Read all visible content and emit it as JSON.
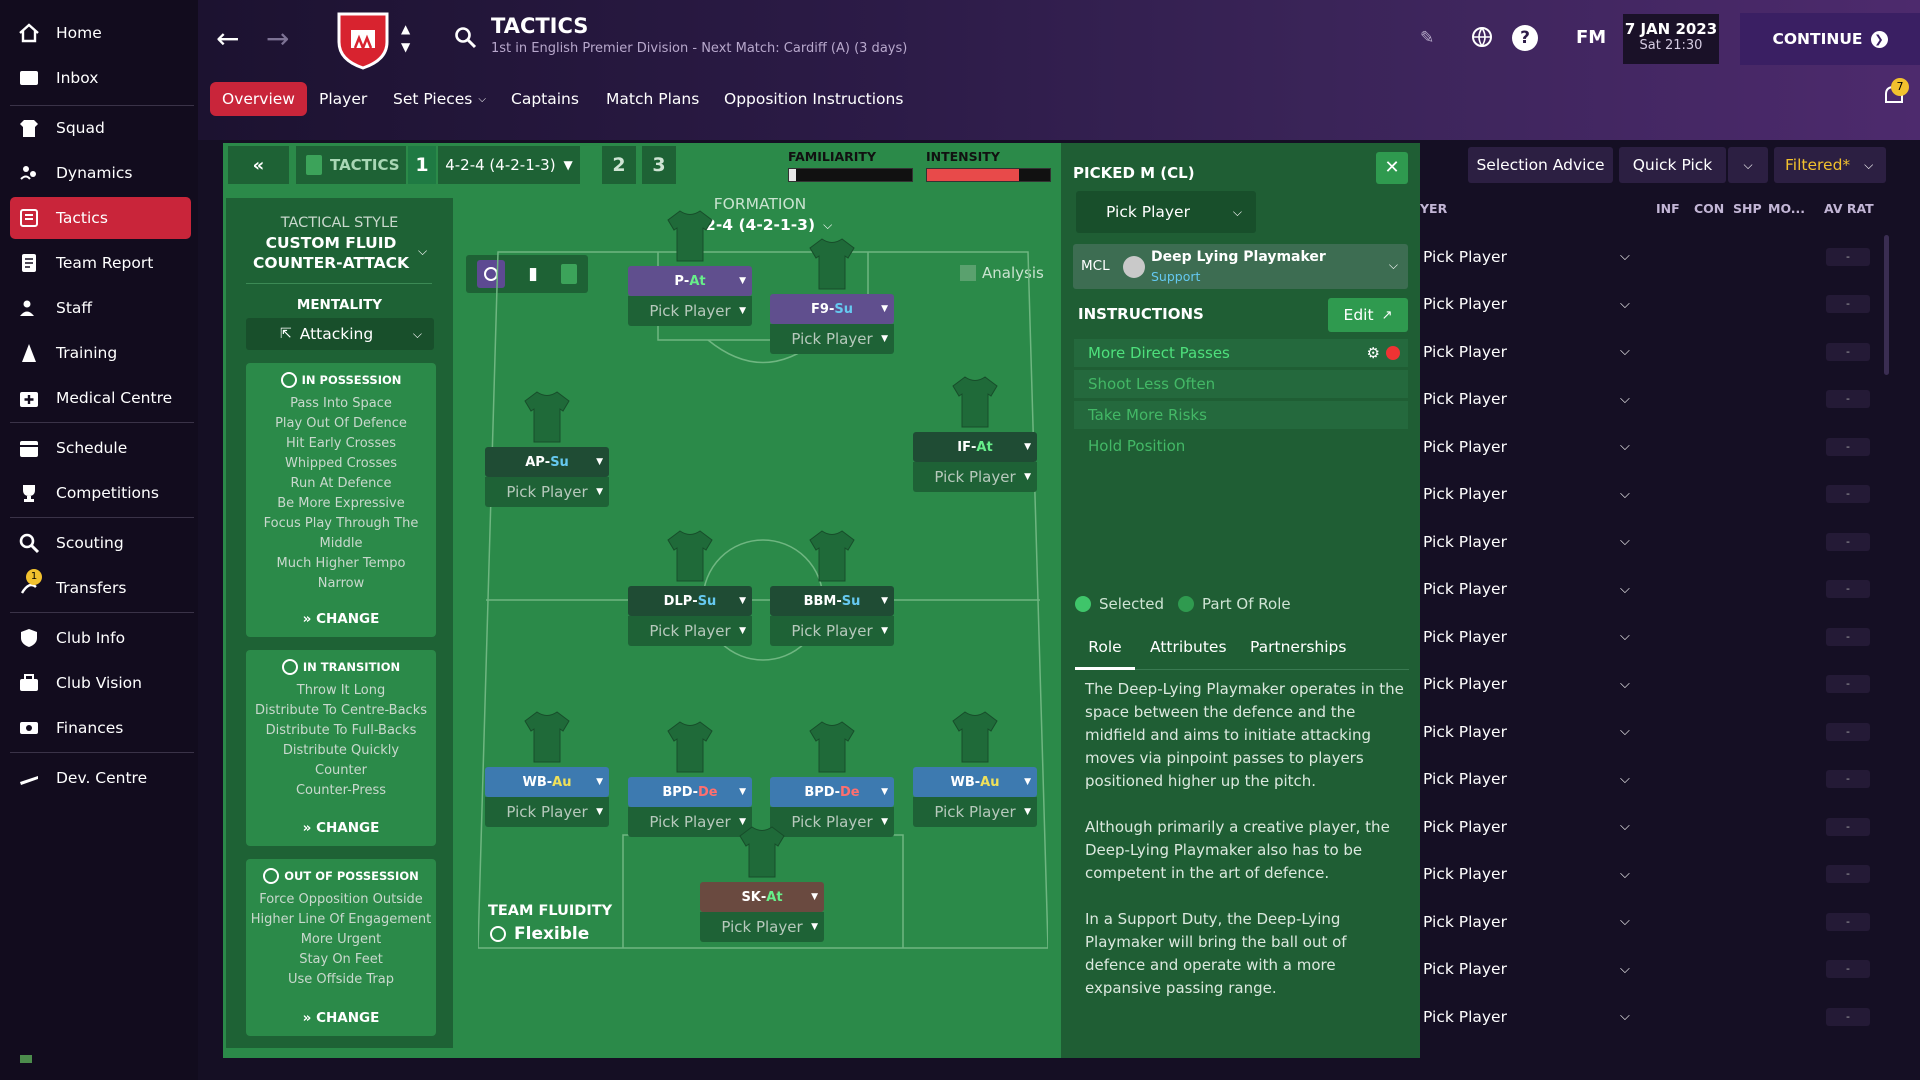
{
  "sidebar": {
    "items": [
      {
        "label": "Home",
        "icon": "home-icon"
      },
      {
        "label": "Inbox",
        "icon": "inbox-icon"
      },
      {
        "label": "Squad",
        "icon": "shirt-icon"
      },
      {
        "label": "Dynamics",
        "icon": "people-icon"
      },
      {
        "label": "Tactics",
        "icon": "tactics-icon"
      },
      {
        "label": "Team Report",
        "icon": "report-icon"
      },
      {
        "label": "Staff",
        "icon": "staff-icon"
      },
      {
        "label": "Training",
        "icon": "training-icon"
      },
      {
        "label": "Medical Centre",
        "icon": "medical-icon"
      },
      {
        "label": "Schedule",
        "icon": "calendar-icon"
      },
      {
        "label": "Competitions",
        "icon": "trophy-icon"
      },
      {
        "label": "Scouting",
        "icon": "magnifier-icon"
      },
      {
        "label": "Transfers",
        "icon": "transfer-icon"
      },
      {
        "label": "Club Info",
        "icon": "shield-icon"
      },
      {
        "label": "Club Vision",
        "icon": "briefcase-icon"
      },
      {
        "label": "Finances",
        "icon": "money-icon"
      },
      {
        "label": "Dev. Centre",
        "icon": "shoe-icon"
      }
    ],
    "transfers_badge": "1"
  },
  "header": {
    "title": "TACTICS",
    "subtitle": "1st in English Premier Division - Next Match: Cardiff (A) (3 days)",
    "fm": "FM",
    "date": "7 JAN 2023",
    "time": "Sat 21:30",
    "continue": "CONTINUE",
    "notif_count": "7"
  },
  "tabs": [
    "Overview",
    "Player",
    "Set Pieces",
    "Captains",
    "Match Plans",
    "Opposition Instructions"
  ],
  "tactic_bar": {
    "label": "TACTICS",
    "slot1": "1",
    "formation": "4-2-4 (4-2-1-3)",
    "slot2": "2",
    "slot3": "3",
    "familiarity": "FAMILIARITY",
    "intensity": "INTENSITY",
    "familiarity_fill": 0.06,
    "intensity_fill": 0.75
  },
  "tactical_style": {
    "heading": "TACTICAL STYLE",
    "name": "CUSTOM FLUID COUNTER-ATTACK",
    "mentality_label": "MENTALITY",
    "mentality": "Attacking"
  },
  "in_possession": {
    "title": "IN POSSESSION",
    "items": [
      "Pass Into Space",
      "Play Out Of Defence",
      "Hit Early Crosses",
      "Whipped Crosses",
      "Run At Defence",
      "Be More Expressive",
      "Focus Play Through The Middle",
      "Much Higher Tempo",
      "Narrow"
    ],
    "change": "CHANGE"
  },
  "in_transition": {
    "title": "IN TRANSITION",
    "items": [
      "Throw It Long",
      "Distribute To Centre-Backs",
      "Distribute To Full-Backs",
      "Distribute Quickly",
      "Counter",
      "Counter-Press"
    ],
    "change": "CHANGE"
  },
  "out_possession": {
    "title": "OUT OF POSSESSION",
    "items": [
      "Force Opposition Outside",
      "Higher Line Of Engagement",
      "More Urgent",
      "Stay On Feet",
      "Use Offside Trap"
    ],
    "change": "CHANGE"
  },
  "formation": {
    "label": "FORMATION",
    "value": "4-2-4 (4-2-1-3)",
    "analysis": "Analysis",
    "fluidity_label": "TEAM FLUIDITY",
    "fluidity": "Flexible",
    "pick": "Pick Player"
  },
  "positions": [
    {
      "role": "P",
      "duty": "At"
    },
    {
      "role": "F9",
      "duty": "Su"
    },
    {
      "role": "AP",
      "duty": "Su"
    },
    {
      "role": "IF",
      "duty": "At"
    },
    {
      "role": "DLP",
      "duty": "Su"
    },
    {
      "role": "BBM",
      "duty": "Su"
    },
    {
      "role": "WB",
      "duty": "Au"
    },
    {
      "role": "BPD",
      "duty": "De"
    },
    {
      "role": "BPD",
      "duty": "De"
    },
    {
      "role": "WB",
      "duty": "Au"
    },
    {
      "role": "SK",
      "duty": "At"
    }
  ],
  "picked": {
    "title": "PICKED M (CL)",
    "pick_player": "Pick Player",
    "pos": "MCL",
    "role": "Deep Lying Playmaker",
    "duty": "Support",
    "instructions_label": "INSTRUCTIONS",
    "edit": "Edit",
    "instructions": [
      "More Direct Passes",
      "Shoot Less Often",
      "Take More Risks",
      "Hold Position"
    ],
    "legend_selected": "Selected",
    "legend_part": "Part Of Role",
    "tabs": [
      "Role",
      "Attributes",
      "Partnerships"
    ],
    "desc": [
      "The Deep-Lying Playmaker operates in the space between the defence and the midfield and aims to initiate attacking moves via pinpoint passes to players positioned higher up the pitch.",
      "Although primarily a creative player, the Deep-Lying Playmaker also has to be competent in the art of defence.",
      "In a Support Duty, the Deep-Lying Playmaker will bring the ball out of defence and operate with a more expansive passing range."
    ]
  },
  "right": {
    "selection_advice": "Selection Advice",
    "quick_pick": "Quick Pick",
    "filtered": "Filtered*",
    "col_player": "YER",
    "cols": [
      "INF",
      "CON",
      "SHP",
      "MO...",
      "AV RAT"
    ],
    "pick": "Pick Player",
    "dash": "-"
  }
}
